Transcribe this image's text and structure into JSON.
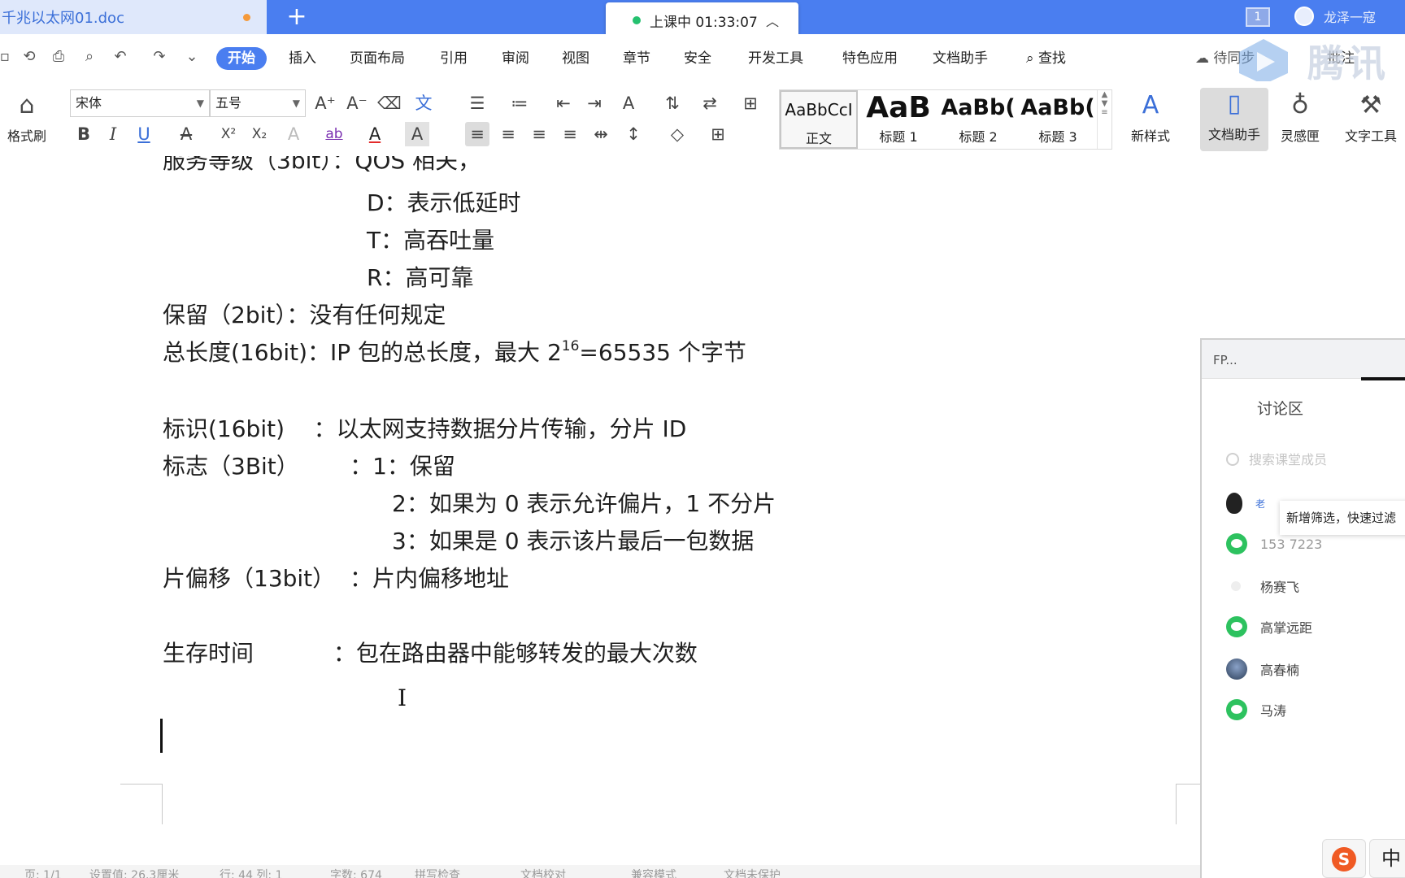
{
  "titlebar": {
    "doc_tab_title": "千兆以太网01.doc",
    "new_tab": "+",
    "class_status": "上课中 01:33:07",
    "page_count": "1",
    "user_name": "龙泽一寇"
  },
  "menubar": {
    "items": [
      "开始",
      "插入",
      "页面布局",
      "引用",
      "审阅",
      "视图",
      "章节",
      "安全",
      "开发工具",
      "特色应用",
      "文档助手"
    ],
    "active_index": 0,
    "find": "查找",
    "sync": "待同步",
    "right_text": "批注",
    "watermark": "腾讯"
  },
  "toolbar": {
    "format_painter": "格式刷",
    "font_name": "宋体",
    "font_size": "五号",
    "styles": [
      {
        "sample": "AaBbCcI",
        "name": "正文"
      },
      {
        "sample": "AaB",
        "name": "标题 1"
      },
      {
        "sample": "AaBb(",
        "name": "标题 2"
      },
      {
        "sample": "AaBb(",
        "name": "标题 3"
      }
    ],
    "new_style": "新样式",
    "doc_helper": "文档助手",
    "inspiration": "灵感匣",
    "text_tools": "文字工具",
    "buttons": {
      "bold": "B",
      "italic": "I",
      "underline": "U",
      "strike": "A",
      "superscript": "X²",
      "subscript": "X₂",
      "font_color": "A",
      "char_shade": "A",
      "highlight": "ab",
      "grow": "A⁺",
      "shrink": "A⁻",
      "pinyin": "文"
    }
  },
  "document": {
    "lines": {
      "l0": "服务等级（3bit）：QOS 相关，",
      "l1": "D：表示低延时",
      "l2": "T：高吞吐量",
      "l3": "R：高可靠",
      "l4": "保留（2bit）：没有任何规定",
      "l5_pre": "总长度(16bit)：IP 包的总长度，最大 2",
      "l5_sup": "16",
      "l5_post": "=65535 个字节",
      "l6": "标识(16bit)    ：以太网支持数据分片传输，分片 ID",
      "l7": "标志（3Bit）       ：1：保留",
      "l8": "2：如果为 0 表示允许偏片，1 不分片",
      "l9": "3：如果是 0 表示该片最后一包数据",
      "l10": "片偏移（13bit）  ：片内偏移地址",
      "l11": "生存时间           ：包在路由器中能够转发的最大次数"
    }
  },
  "side_panel": {
    "title": "FP...",
    "tab": "讨论区",
    "search_placeholder": "搜索课堂成员",
    "tooltip": "新增筛选，快速过滤",
    "members": [
      {
        "name": "老",
        "avatar": "qq"
      },
      {
        "name": "153     7223",
        "avatar": "wechat"
      },
      {
        "name": "杨赛飞",
        "avatar": "blank"
      },
      {
        "name": "高掌远距",
        "avatar": "wechat"
      },
      {
        "name": "高春楠",
        "avatar": "photo"
      },
      {
        "name": "马涛",
        "avatar": "wechat"
      }
    ]
  },
  "statusbar": {
    "items": [
      "页: 1/1",
      "设置值: 26.3厘米",
      "行: 44  列: 1",
      "字数: 674",
      "拼写检查",
      "文档校对",
      "兼容模式",
      "文档未保护"
    ]
  },
  "ime": {
    "sogou": "S",
    "lang": "中"
  }
}
